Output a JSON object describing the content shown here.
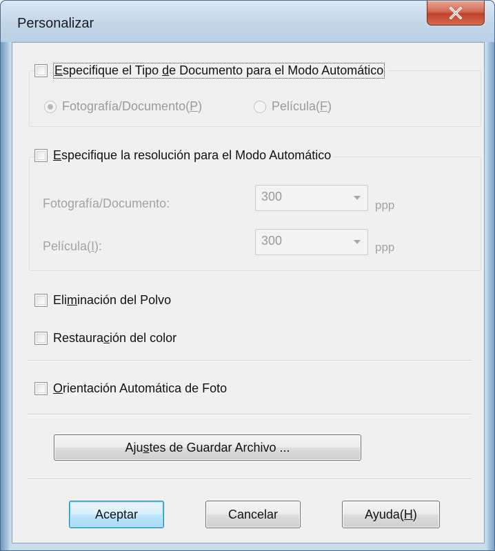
{
  "window": {
    "title": "Personalizar"
  },
  "doc_type": {
    "checkbox_prefix": "",
    "checkbox_mnemonic": "E",
    "checkbox_rest1": "specifique el Tipo ",
    "checkbox_mnemonic2": "d",
    "checkbox_rest2": "e Documento para el Modo Automático",
    "checked": false,
    "options": [
      {
        "label_main": "Fotografía/Documento(",
        "mnemonic": "P",
        "suffix": ")",
        "selected": true
      },
      {
        "label_main": "Película(",
        "mnemonic": "F",
        "suffix": ")",
        "selected": false
      }
    ]
  },
  "resolution": {
    "checkbox_mnemonic": "E",
    "checkbox_rest": "specifique la resolución para el Modo Automático",
    "checked": false,
    "photo_label": "Fotografía/Documento:",
    "photo_value": "300",
    "film_label_main": "Película(",
    "film_mnemonic": "I",
    "film_suffix": "):",
    "film_value": "300",
    "unit": "ppp"
  },
  "dust": {
    "pre": "Eli",
    "mnemonic": "m",
    "post": "inación del Polvo",
    "checked": false
  },
  "color": {
    "pre": "Restaura",
    "mnemonic": "c",
    "post": "ión del color",
    "checked": false
  },
  "orientation": {
    "mnemonic": "O",
    "post": "rientación Automática de Foto",
    "checked": false
  },
  "save_settings": {
    "pre": "Aju",
    "mnemonic": "s",
    "post": "tes de Guardar Archivo ..."
  },
  "buttons": {
    "ok": "Aceptar",
    "cancel": "Cancelar",
    "help_main": "Ayuda(",
    "help_mnemonic": "H",
    "help_suffix": ")"
  },
  "icons": {
    "close": "close-icon"
  }
}
